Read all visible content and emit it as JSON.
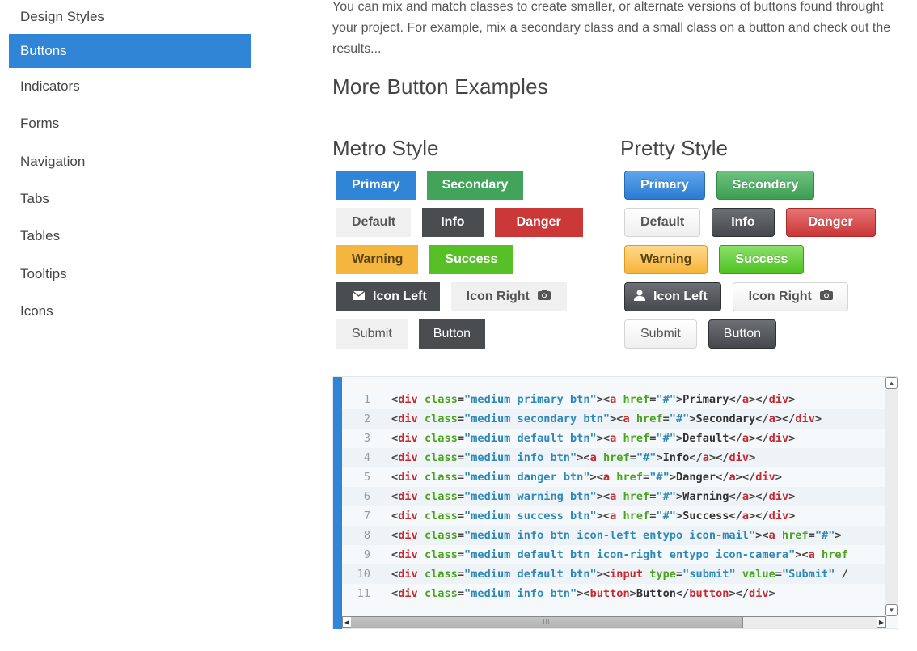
{
  "sidebar": {
    "items": [
      {
        "label": "Design Styles",
        "active": false
      },
      {
        "label": "Buttons",
        "active": true
      },
      {
        "label": "Indicators",
        "active": false
      },
      {
        "label": "Forms",
        "active": false
      },
      {
        "label": "Navigation",
        "active": false
      },
      {
        "label": "Tabs",
        "active": false
      },
      {
        "label": "Tables",
        "active": false
      },
      {
        "label": "Tooltips",
        "active": false
      },
      {
        "label": "Icons",
        "active": false
      }
    ],
    "active_color": "#3085d6"
  },
  "main": {
    "intro": "You can mix and match classes to create smaller, or alternate versions of buttons found throught your project. For example, mix a secondary class and a small class on a button and check out the results...",
    "heading": "More Button Examples",
    "metro": {
      "title": "Metro Style",
      "buttons": {
        "primary": "Primary",
        "secondary": "Secondary",
        "default": "Default",
        "info": "Info",
        "danger": "Danger",
        "warning": "Warning",
        "success": "Success",
        "icon_left": "Icon Left",
        "icon_right": "Icon Right",
        "submit": "Submit",
        "button": "Button"
      },
      "icons": {
        "icon_left": "mail-icon",
        "icon_right": "camera-icon"
      }
    },
    "pretty": {
      "title": "Pretty Style",
      "buttons": {
        "primary": "Primary",
        "secondary": "Secondary",
        "default": "Default",
        "info": "Info",
        "danger": "Danger",
        "warning": "Warning",
        "success": "Success",
        "icon_left": "Icon Left",
        "icon_right": "Icon Right",
        "submit": "Submit",
        "button": "Button"
      },
      "icons": {
        "icon_left": "user-icon",
        "icon_right": "camera-icon"
      }
    },
    "colors": {
      "primary": "#3085d6",
      "secondary": "#42a35a",
      "default": "#f0f0f0",
      "info": "#4a4d50",
      "danger": "#ca3838",
      "warning": "#f4b63f",
      "success": "#57c027"
    }
  },
  "code": {
    "lines": [
      {
        "n": "1",
        "tokens": [
          [
            "t",
            "<"
          ],
          [
            "g",
            "div"
          ],
          [
            "p",
            " "
          ],
          [
            "a",
            "class"
          ],
          [
            "p",
            "="
          ],
          [
            "s",
            "\"medium primary btn\""
          ],
          [
            "p",
            ">"
          ],
          [
            "p",
            "<"
          ],
          [
            "g",
            "a"
          ],
          [
            "p",
            " "
          ],
          [
            "a",
            "href"
          ],
          [
            "p",
            "="
          ],
          [
            "s",
            "\"#\""
          ],
          [
            "p",
            ">"
          ],
          [
            "x",
            "Primary"
          ],
          [
            "p",
            "</"
          ],
          [
            "g",
            "a"
          ],
          [
            "p",
            "></"
          ],
          [
            "g",
            "div"
          ],
          [
            "p",
            ">"
          ]
        ]
      },
      {
        "n": "2",
        "tokens": [
          [
            "t",
            "<"
          ],
          [
            "g",
            "div"
          ],
          [
            "p",
            " "
          ],
          [
            "a",
            "class"
          ],
          [
            "p",
            "="
          ],
          [
            "s",
            "\"medium secondary btn\""
          ],
          [
            "p",
            ">"
          ],
          [
            "p",
            "<"
          ],
          [
            "g",
            "a"
          ],
          [
            "p",
            " "
          ],
          [
            "a",
            "href"
          ],
          [
            "p",
            "="
          ],
          [
            "s",
            "\"#\""
          ],
          [
            "p",
            ">"
          ],
          [
            "x",
            "Secondary"
          ],
          [
            "p",
            "</"
          ],
          [
            "g",
            "a"
          ],
          [
            "p",
            "></"
          ],
          [
            "g",
            "div"
          ],
          [
            "p",
            ">"
          ]
        ]
      },
      {
        "n": "3",
        "tokens": [
          [
            "t",
            "<"
          ],
          [
            "g",
            "div"
          ],
          [
            "p",
            " "
          ],
          [
            "a",
            "class"
          ],
          [
            "p",
            "="
          ],
          [
            "s",
            "\"medium default btn\""
          ],
          [
            "p",
            ">"
          ],
          [
            "p",
            "<"
          ],
          [
            "g",
            "a"
          ],
          [
            "p",
            " "
          ],
          [
            "a",
            "href"
          ],
          [
            "p",
            "="
          ],
          [
            "s",
            "\"#\""
          ],
          [
            "p",
            ">"
          ],
          [
            "x",
            "Default"
          ],
          [
            "p",
            "</"
          ],
          [
            "g",
            "a"
          ],
          [
            "p",
            "></"
          ],
          [
            "g",
            "div"
          ],
          [
            "p",
            ">"
          ]
        ]
      },
      {
        "n": "4",
        "tokens": [
          [
            "t",
            "<"
          ],
          [
            "g",
            "div"
          ],
          [
            "p",
            " "
          ],
          [
            "a",
            "class"
          ],
          [
            "p",
            "="
          ],
          [
            "s",
            "\"medium info btn\""
          ],
          [
            "p",
            ">"
          ],
          [
            "p",
            "<"
          ],
          [
            "g",
            "a"
          ],
          [
            "p",
            " "
          ],
          [
            "a",
            "href"
          ],
          [
            "p",
            "="
          ],
          [
            "s",
            "\"#\""
          ],
          [
            "p",
            ">"
          ],
          [
            "x",
            "Info"
          ],
          [
            "p",
            "</"
          ],
          [
            "g",
            "a"
          ],
          [
            "p",
            "></"
          ],
          [
            "g",
            "div"
          ],
          [
            "p",
            ">"
          ]
        ]
      },
      {
        "n": "5",
        "tokens": [
          [
            "t",
            "<"
          ],
          [
            "g",
            "div"
          ],
          [
            "p",
            " "
          ],
          [
            "a",
            "class"
          ],
          [
            "p",
            "="
          ],
          [
            "s",
            "\"medium danger btn\""
          ],
          [
            "p",
            ">"
          ],
          [
            "p",
            "<"
          ],
          [
            "g",
            "a"
          ],
          [
            "p",
            " "
          ],
          [
            "a",
            "href"
          ],
          [
            "p",
            "="
          ],
          [
            "s",
            "\"#\""
          ],
          [
            "p",
            ">"
          ],
          [
            "x",
            "Danger"
          ],
          [
            "p",
            "</"
          ],
          [
            "g",
            "a"
          ],
          [
            "p",
            "></"
          ],
          [
            "g",
            "div"
          ],
          [
            "p",
            ">"
          ]
        ]
      },
      {
        "n": "6",
        "tokens": [
          [
            "t",
            "<"
          ],
          [
            "g",
            "div"
          ],
          [
            "p",
            " "
          ],
          [
            "a",
            "class"
          ],
          [
            "p",
            "="
          ],
          [
            "s",
            "\"medium warning btn\""
          ],
          [
            "p",
            ">"
          ],
          [
            "p",
            "<"
          ],
          [
            "g",
            "a"
          ],
          [
            "p",
            " "
          ],
          [
            "a",
            "href"
          ],
          [
            "p",
            "="
          ],
          [
            "s",
            "\"#\""
          ],
          [
            "p",
            ">"
          ],
          [
            "x",
            "Warning"
          ],
          [
            "p",
            "</"
          ],
          [
            "g",
            "a"
          ],
          [
            "p",
            "></"
          ],
          [
            "g",
            "div"
          ],
          [
            "p",
            ">"
          ]
        ]
      },
      {
        "n": "7",
        "tokens": [
          [
            "t",
            "<"
          ],
          [
            "g",
            "div"
          ],
          [
            "p",
            " "
          ],
          [
            "a",
            "class"
          ],
          [
            "p",
            "="
          ],
          [
            "s",
            "\"medium success btn\""
          ],
          [
            "p",
            ">"
          ],
          [
            "p",
            "<"
          ],
          [
            "g",
            "a"
          ],
          [
            "p",
            " "
          ],
          [
            "a",
            "href"
          ],
          [
            "p",
            "="
          ],
          [
            "s",
            "\"#\""
          ],
          [
            "p",
            ">"
          ],
          [
            "x",
            "Success"
          ],
          [
            "p",
            "</"
          ],
          [
            "g",
            "a"
          ],
          [
            "p",
            "></"
          ],
          [
            "g",
            "div"
          ],
          [
            "p",
            ">"
          ]
        ]
      },
      {
        "n": "8",
        "tokens": [
          [
            "t",
            "<"
          ],
          [
            "g",
            "div"
          ],
          [
            "p",
            " "
          ],
          [
            "a",
            "class"
          ],
          [
            "p",
            "="
          ],
          [
            "s",
            "\"medium info btn icon-left entypo icon-mail\""
          ],
          [
            "p",
            ">"
          ],
          [
            "p",
            "<"
          ],
          [
            "g",
            "a"
          ],
          [
            "p",
            " "
          ],
          [
            "a",
            "href"
          ],
          [
            "p",
            "="
          ],
          [
            "s",
            "\"#\""
          ],
          [
            "p",
            ">"
          ]
        ]
      },
      {
        "n": "9",
        "tokens": [
          [
            "t",
            "<"
          ],
          [
            "g",
            "div"
          ],
          [
            "p",
            " "
          ],
          [
            "a",
            "class"
          ],
          [
            "p",
            "="
          ],
          [
            "s",
            "\"medium default btn icon-right entypo icon-camera\""
          ],
          [
            "p",
            ">"
          ],
          [
            "p",
            "<"
          ],
          [
            "g",
            "a"
          ],
          [
            "p",
            " "
          ],
          [
            "a",
            "href"
          ]
        ]
      },
      {
        "n": "10",
        "tokens": [
          [
            "t",
            "<"
          ],
          [
            "g",
            "div"
          ],
          [
            "p",
            " "
          ],
          [
            "a",
            "class"
          ],
          [
            "p",
            "="
          ],
          [
            "s",
            "\"medium default btn\""
          ],
          [
            "p",
            ">"
          ],
          [
            "p",
            "<"
          ],
          [
            "g",
            "input"
          ],
          [
            "p",
            " "
          ],
          [
            "a",
            "type"
          ],
          [
            "p",
            "="
          ],
          [
            "s",
            "\"submit\""
          ],
          [
            "p",
            " "
          ],
          [
            "a",
            "value"
          ],
          [
            "p",
            "="
          ],
          [
            "s",
            "\"Submit\""
          ],
          [
            "p",
            " /"
          ]
        ]
      },
      {
        "n": "11",
        "tokens": [
          [
            "t",
            "<"
          ],
          [
            "g",
            "div"
          ],
          [
            "p",
            " "
          ],
          [
            "a",
            "class"
          ],
          [
            "p",
            "="
          ],
          [
            "s",
            "\"medium info btn\""
          ],
          [
            "p",
            ">"
          ],
          [
            "p",
            "<"
          ],
          [
            "g",
            "button"
          ],
          [
            "p",
            ">"
          ],
          [
            "x",
            "Button"
          ],
          [
            "p",
            "</"
          ],
          [
            "g",
            "button"
          ],
          [
            "p",
            "></"
          ],
          [
            "g",
            "div"
          ],
          [
            "p",
            ">"
          ]
        ]
      }
    ],
    "scrollbar": {
      "h_grip": "III"
    },
    "accent_bar_color": "#3085d6"
  }
}
